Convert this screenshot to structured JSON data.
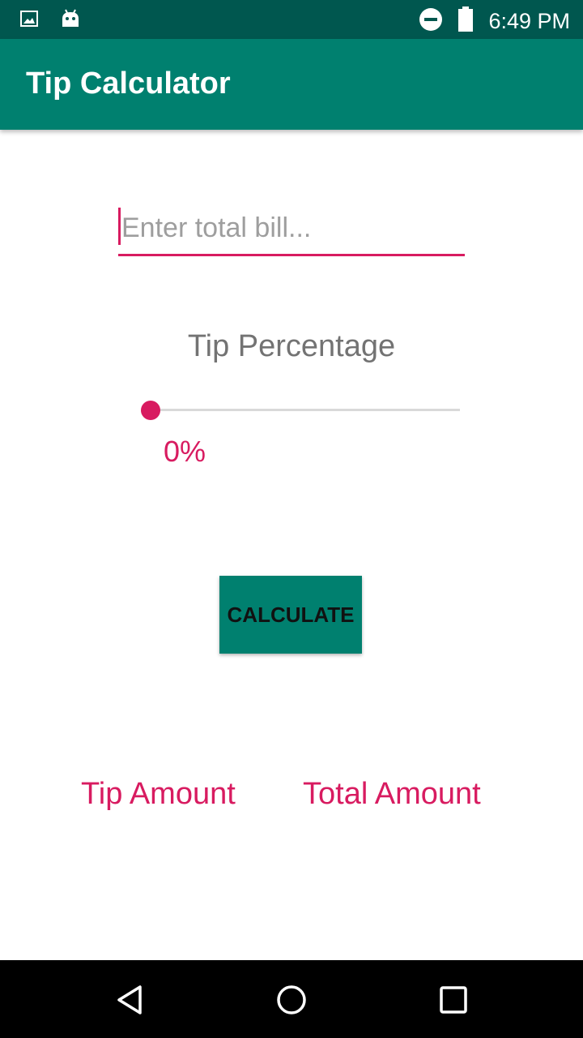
{
  "status_bar": {
    "time": "6:49 PM",
    "left_icons": [
      "image-icon",
      "android-icon"
    ],
    "right_icons": [
      "do-not-disturb-icon",
      "battery-icon"
    ]
  },
  "app_bar": {
    "title": "Tip Calculator"
  },
  "bill_input": {
    "value": "",
    "placeholder": "Enter total bill..."
  },
  "tip": {
    "label": "Tip Percentage",
    "percent_label": "0%",
    "slider_value": 0
  },
  "calculate_button": {
    "label": "CALCULATE"
  },
  "results": {
    "tip_amount_label": "Tip Amount",
    "total_amount_label": "Total Amount"
  },
  "nav_bar": {
    "buttons": [
      "back-icon",
      "home-icon",
      "recents-icon"
    ]
  },
  "colors": {
    "primary": "#00806f",
    "primary_dark": "#00574f",
    "accent": "#d81b60"
  }
}
